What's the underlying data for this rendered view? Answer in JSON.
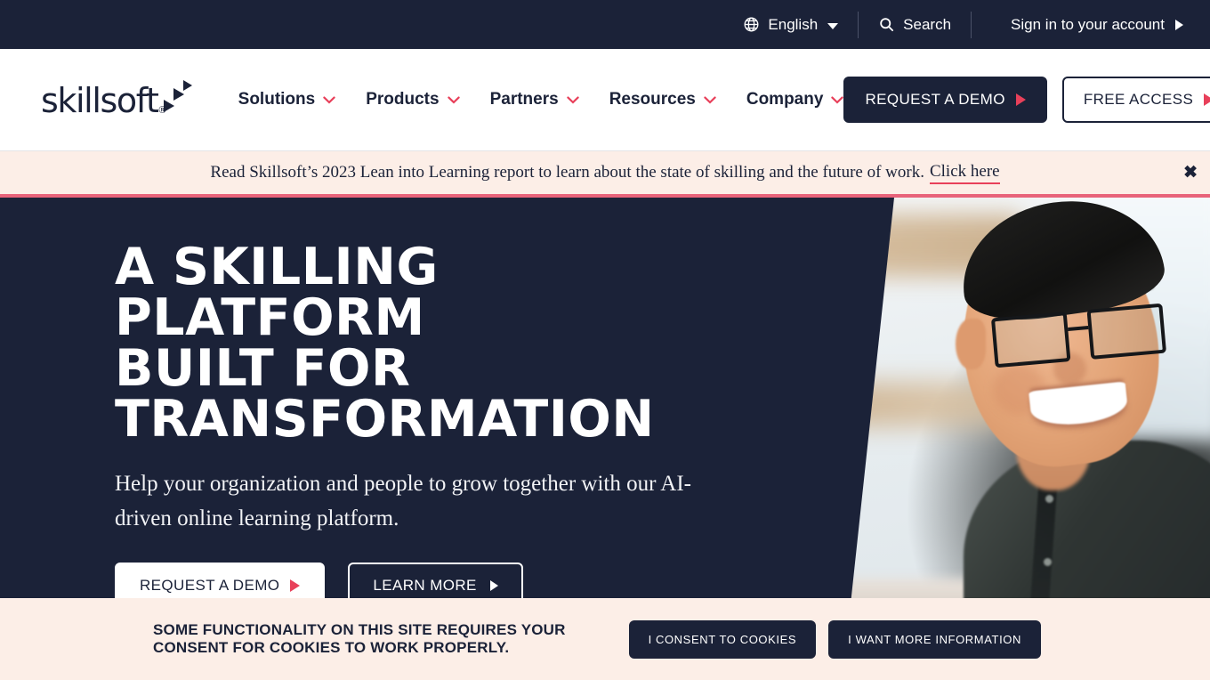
{
  "topbar": {
    "language": "English",
    "language_icon": "globe-icon",
    "search": "Search",
    "search_icon": "search-icon",
    "signin": "Sign in to your account",
    "signin_icon": "triangle-right-icon"
  },
  "header": {
    "logo_word": "skillsoft",
    "logo_registered": "®",
    "nav": [
      {
        "label": "Solutions"
      },
      {
        "label": "Products"
      },
      {
        "label": "Partners"
      },
      {
        "label": "Resources"
      },
      {
        "label": "Company"
      }
    ],
    "request_demo": "REQUEST A DEMO",
    "free_access": "FREE ACCESS"
  },
  "promo": {
    "text": "Read Skillsoft’s 2023 Lean into Learning report to learn about the state of skilling and the future of work.",
    "link": "Click here",
    "close_icon": "close-icon",
    "close_glyph": "✖"
  },
  "hero": {
    "title_line1": "A SKILLING PLATFORM",
    "title_line2": "BUILT FOR",
    "title_line3": "TRANSFORMATION",
    "subtitle": "Help your organization and people to grow together with our AI-driven online learning platform.",
    "cta_primary": "REQUEST A DEMO",
    "cta_secondary": "LEARN MORE"
  },
  "cookie": {
    "line1": "SOME FUNCTIONALITY ON THIS SITE REQUIRES YOUR",
    "line2": "CONSENT FOR COOKIES TO WORK PROPERLY.",
    "consent": "I CONSENT TO COOKIES",
    "more_info": "I WANT MORE INFORMATION"
  },
  "colors": {
    "navy": "#1b2238",
    "accent_red": "#e8405a",
    "banner_cream": "#fceee7",
    "banner_border": "#e8637a",
    "white": "#ffffff"
  }
}
